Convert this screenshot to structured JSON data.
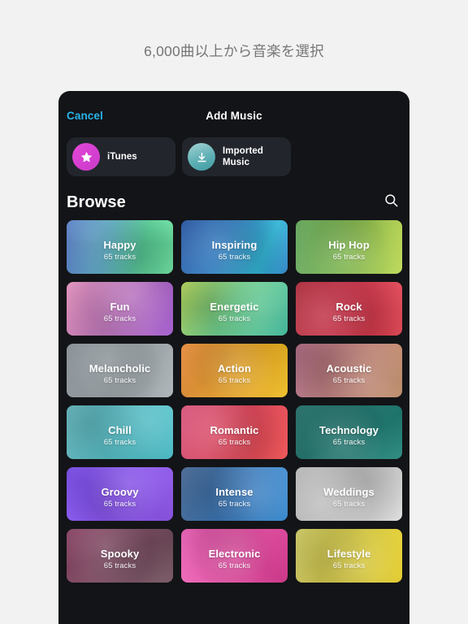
{
  "caption": "6,000曲以上から音楽を選択",
  "nav": {
    "cancel_label": "Cancel",
    "title": "Add Music",
    "cancel_color": "#28b4e8"
  },
  "sources": [
    {
      "label": "iTunes",
      "icon": "star-icon",
      "color": "#d63fd0"
    },
    {
      "label": "Imported\nMusic",
      "label_line1": "Imported",
      "label_line2": "Music",
      "icon": "download-icon",
      "color": "#5fb0b4"
    }
  ],
  "browse": {
    "title": "Browse",
    "search_icon": "search-icon"
  },
  "categories": [
    {
      "name": "Happy",
      "tracks": "65 tracks",
      "gradient": "linear-gradient(100deg, #4b74c4 0%, #4d9fb8 38%, #59d49a 72%, #6de8a4 100%)"
    },
    {
      "name": "Inspiring",
      "tracks": "65 tracks",
      "gradient": "linear-gradient(115deg, #2f5fb0 0%, #2f7fc8 40%, #2fb7d8 75%, #2f8ad0 100%)"
    },
    {
      "name": "Hip Hop",
      "tracks": "65 tracks",
      "gradient": "linear-gradient(95deg, #63a85a 0%, #86c254 45%, #bcd94f 100%)"
    },
    {
      "name": "Fun",
      "tracks": "65 tracks",
      "gradient": "linear-gradient(110deg, #e08ab8 0%, #cd7fc6 40%, #a95fd8 100%)"
    },
    {
      "name": "Energetic",
      "tracks": "65 tracks",
      "gradient": "linear-gradient(120deg, #b8dc5a 0%, #6ed08a 45%, #3ec4a4 100%)"
    },
    {
      "name": "Rock",
      "tracks": "65 tracks",
      "gradient": "linear-gradient(110deg, #b82f3f 0%, #d03048 45%, #e8414f 100%)"
    },
    {
      "name": "Melancholic",
      "tracks": "65 tracks",
      "gradient": "linear-gradient(120deg, #8e969c 0%, #9aa3a8 50%, #a8afb4 100%)"
    },
    {
      "name": "Action",
      "tracks": "65 tracks",
      "gradient": "linear-gradient(110deg, #e88a3a 0%, #f0a62c 45%, #f5c21e 100%)"
    },
    {
      "name": "Acoustic",
      "tracks": "65 tracks",
      "gradient": "linear-gradient(110deg, #b06a84 0%, #c07f78 50%, #d09a72 100%)"
    },
    {
      "name": "Chill",
      "tracks": "65 tracks",
      "gradient": "linear-gradient(120deg, #6cc4cc 0%, #55c0c8 50%, #3fbcc8 100%)"
    },
    {
      "name": "Romantic",
      "tracks": "65 tracks",
      "gradient": "linear-gradient(115deg, #e0537f 0%, #e8485f 50%, #ef4a4a 100%)"
    },
    {
      "name": "Technology",
      "tracks": "65 tracks",
      "gradient": "linear-gradient(120deg, #1d6a64 0%, #1f7a72 50%, #22877c 100%)"
    },
    {
      "name": "Groovy",
      "tracks": "65 tracks",
      "gradient": "linear-gradient(120deg, #7c4ef0 0%, #8a52f4 50%, #9a5ef8 100%)"
    },
    {
      "name": "Intense",
      "tracks": "65 tracks",
      "gradient": "linear-gradient(115deg, #4a6d9c 0%, #3a7cc0 55%, #2f8ad8 100%)"
    },
    {
      "name": "Weddings",
      "tracks": "65 tracks",
      "gradient": "linear-gradient(120deg, #bcbcbc 0%, #cccccc 50%, #dcdcdc 100%)"
    },
    {
      "name": "Spooky",
      "tracks": "65 tracks",
      "gradient": "linear-gradient(120deg, #8e4468 0%, #7a4a60 55%, #6a4a56 100%)"
    },
    {
      "name": "Electronic",
      "tracks": "65 tracks",
      "gradient": "linear-gradient(115deg, #ef62ba 0%, #ea4ea6 55%, #e63f9a 100%)"
    },
    {
      "name": "Lifestyle",
      "tracks": "65 tracks",
      "gradient": "linear-gradient(110deg, #c8c45c 0%, #ddd044 50%, #f2d92a 100%)"
    }
  ]
}
